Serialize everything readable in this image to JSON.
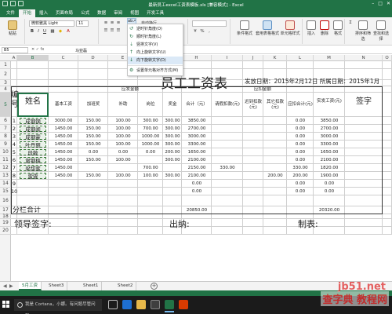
{
  "window": {
    "title": "最新员工excel工资表模板.xls [兼容模式] - Excel"
  },
  "ribbon_tabs": [
    "文件",
    "开始",
    "插入",
    "页面布局",
    "公式",
    "数据",
    "审阅",
    "视图",
    "开发工具"
  ],
  "active_tab_index": 1,
  "ribbon": {
    "font_name": "微软雅黑 Light",
    "font_size": "11",
    "wrap_label": "自动换行",
    "paste_label": "粘贴",
    "clipboard_label": "剪贴板",
    "conditional_format_label": "条件格式",
    "format_as_table_label": "套用表格格式",
    "cell_styles_label": "单元格样式",
    "insert_label": "插入",
    "delete_label": "删除",
    "format_label": "格式",
    "sort_filter_label": "排序和筛选",
    "find_select_label": "查找和选择"
  },
  "orientation_menu": {
    "items": [
      {
        "label": "逆时针角度(O)",
        "icon": "rotate-ccw-icon"
      },
      {
        "label": "顺时针角度(L)",
        "icon": "rotate-cw-icon"
      },
      {
        "label": "竖排文字(V)",
        "icon": "vertical-text-icon"
      },
      {
        "label": "向上旋转文字(U)",
        "icon": "rotate-up-icon"
      },
      {
        "label": "向下旋转文字(D)",
        "icon": "rotate-down-icon"
      },
      {
        "label": "设置单元格对齐方式(M)",
        "icon": "format-alignment-icon"
      }
    ],
    "highlighted_index": 4
  },
  "formula_bar": {
    "name_box": "B5",
    "value": "马亚磊"
  },
  "columns": [
    "A",
    "B",
    "C",
    "D",
    "E",
    "F",
    "G",
    "H",
    "I",
    "J",
    "K",
    "L",
    "M",
    "N",
    "O"
  ],
  "selected_column": "B",
  "rows": [
    "1",
    "2",
    "3",
    "4",
    "5",
    "6",
    "7",
    "8",
    "9",
    "10",
    "11",
    "12",
    "13",
    "14",
    "15",
    "16",
    "17",
    "18",
    "19",
    "20"
  ],
  "sheet": {
    "title": "员工工资表",
    "date_info": "发放日期：2015年2月12日 所属日期：2015年1月",
    "header_no": "编号",
    "header_name": "姓名",
    "header_payable": "应发金额",
    "header_deduct": "应扣金额",
    "header_actual": "实发工资(元)",
    "header_sign": "签字",
    "sub_headers": {
      "basic": "基本工资",
      "overtime": "加班奖",
      "allowance": "补助",
      "position": "岗位",
      "bonus": "奖金",
      "total": "合计（元）",
      "leave": "请假扣款(元)",
      "late": "迟到扣款(元)",
      "other": "其它扣款(元)",
      "deduct_total": "应扣合计(元)"
    },
    "employees": [
      {
        "no": "1",
        "name": "成钢钢",
        "basic": "3000.00",
        "overtime": "150.00",
        "allowance": "100.00",
        "position": "300.00",
        "bonus": "300.00",
        "total": "3850.00",
        "leave": "",
        "late": "",
        "other": "",
        "deduct": "0.00",
        "actual": "3850.00"
      },
      {
        "no": "2",
        "name": "成钢闻",
        "basic": "1450.00",
        "overtime": "150.00",
        "allowance": "100.00",
        "position": "700.00",
        "bonus": "300.00",
        "total": "2700.00",
        "leave": "",
        "late": "",
        "other": "",
        "deduct": "0.00",
        "actual": "2700.00"
      },
      {
        "no": "3",
        "name": "成钢霍",
        "basic": "1450.00",
        "overtime": "150.00",
        "allowance": "100.00",
        "position": "1000.00",
        "bonus": "300.00",
        "total": "3000.00",
        "leave": "",
        "late": "",
        "other": "",
        "deduct": "0.00",
        "actual": "3000.00"
      },
      {
        "no": "4",
        "name": "叶丹丽",
        "basic": "1450.00",
        "overtime": "150.00",
        "allowance": "100.00",
        "position": "1000.00",
        "bonus": "300.00",
        "total": "3300.00",
        "leave": "",
        "late": "",
        "other": "",
        "deduct": "0.00",
        "actual": "3300.00"
      },
      {
        "no": "5",
        "name": "段敏",
        "basic": "1450.00",
        "overtime": "0.00",
        "allowance": "0.00",
        "position": "0.00",
        "bonus": "200.00",
        "total": "1650.00",
        "leave": "",
        "late": "",
        "other": "",
        "deduct": "0.00",
        "actual": "1650.00"
      },
      {
        "no": "6",
        "name": "谢钢梅",
        "basic": "1450.00",
        "overtime": "150.00",
        "allowance": "100.00",
        "position": "",
        "bonus": "300.00",
        "total": "2100.00",
        "leave": "",
        "late": "",
        "other": "",
        "deduct": "0.00",
        "actual": "2100.00"
      },
      {
        "no": "7",
        "name": "梁甜蜜",
        "basic": "1450.00",
        "overtime": "",
        "allowance": "",
        "position": "700.00",
        "bonus": "",
        "total": "2150.00",
        "leave": "330.00",
        "late": "",
        "other": "",
        "deduct": "330.00",
        "actual": "1820.00"
      },
      {
        "no": "8",
        "name": "雷霆",
        "basic": "1450.00",
        "overtime": "150.00",
        "allowance": "100.00",
        "position": "100.00",
        "bonus": "300.00",
        "total": "2100.00",
        "leave": "",
        "late": "",
        "other": "200.00",
        "deduct": "200.00",
        "actual": "1900.00"
      },
      {
        "no": "9",
        "name": "",
        "basic": "",
        "overtime": "",
        "allowance": "",
        "position": "",
        "bonus": "",
        "total": "0.00",
        "leave": "",
        "late": "",
        "other": "",
        "deduct": "0.00",
        "actual": "0.00"
      },
      {
        "no": "10",
        "name": "",
        "basic": "",
        "overtime": "",
        "allowance": "",
        "position": "",
        "bonus": "",
        "total": "0.00",
        "leave": "",
        "late": "",
        "other": "",
        "deduct": "0.00",
        "actual": "0.00"
      }
    ],
    "subtotal_label": "分栏合计",
    "subtotal_total": "20850.00",
    "subtotal_actual": "20320.00",
    "sig_leader": "领导签字:",
    "sig_cashier": "出纳:",
    "sig_maker": "制表:"
  },
  "sheet_tabs": [
    "5月工资",
    "Sheet3",
    "Sheet1",
    "Sheet2"
  ],
  "active_sheet_index": 0,
  "taskbar": {
    "search_placeholder": "我是 Cortana，小娜。有问题尽管问我。",
    "time": "",
    "date": ""
  },
  "watermark": {
    "line1": "jb51.net",
    "line2": "查字典 教程网"
  },
  "colors": {
    "excel_green": "#217346",
    "highlight_blue": "#dbe9f7",
    "name_cell_bg": "#e9f1e9",
    "watermark_red": "#e03030"
  }
}
